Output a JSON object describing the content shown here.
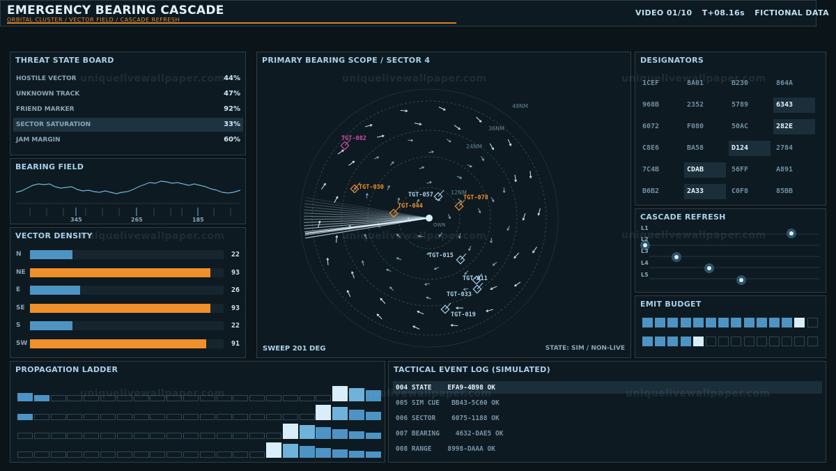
{
  "header": {
    "title": "EMERGENCY BEARING CASCADE",
    "subtitle": "ORBITAL CLUSTER / VECTOR FIELD / CASCADE REFRESH",
    "video": "VIDEO 01/10",
    "time": "T+08.16s",
    "tag": "FICTIONAL DATA"
  },
  "watermark": "uniquelivewallpaper.com",
  "threat_board": {
    "title": "THREAT STATE BOARD",
    "rows": [
      {
        "label": "HOSTILE VECTOR",
        "value": "44%"
      },
      {
        "label": "UNKNOWN TRACK",
        "value": "47%"
      },
      {
        "label": "FRIEND MARKER",
        "value": "92%"
      },
      {
        "label": "SECTOR SATURATION",
        "value": "33%"
      },
      {
        "label": "JAM MARGIN",
        "value": "60%"
      }
    ],
    "highlight_index": 3
  },
  "bearing_field": {
    "title": "BEARING FIELD",
    "ticks": [
      "345",
      "265",
      "185"
    ]
  },
  "vector_density": {
    "title": "VECTOR DENSITY",
    "rows": [
      {
        "label": "N",
        "value": 22,
        "color": "#4d94c4"
      },
      {
        "label": "NE",
        "value": 93,
        "color": "#f0902b"
      },
      {
        "label": "E",
        "value": 26,
        "color": "#4d94c4"
      },
      {
        "label": "SE",
        "value": 93,
        "color": "#f0902b"
      },
      {
        "label": "S",
        "value": 22,
        "color": "#4d94c4"
      },
      {
        "label": "SW",
        "value": 91,
        "color": "#f0902b"
      }
    ],
    "max": 100
  },
  "scope": {
    "title": "PRIMARY BEARING SCOPE / SECTOR 4",
    "sweep": "SWEEP 201 DEG",
    "state": "STATE: SIM / NON-LIVE",
    "rings": [
      "12NM",
      "24NM",
      "36NM",
      "48NM"
    ],
    "own": "OWN",
    "targets": [
      {
        "label": "TGT-082",
        "color": "#c94fa6"
      },
      {
        "label": "TGT-030",
        "color": "#f0902b"
      },
      {
        "label": "TGT-057",
        "color": "#a9d1ea"
      },
      {
        "label": "TGT-078",
        "color": "#f0902b"
      },
      {
        "label": "TGT-044",
        "color": "#f0902b"
      },
      {
        "label": "TGT-015",
        "color": "#a9d1ea"
      },
      {
        "label": "TGT-011",
        "color": "#a9d1ea"
      },
      {
        "label": "TGT-033",
        "color": "#a9d1ea"
      },
      {
        "label": "TGT-019",
        "color": "#a9d1ea"
      }
    ]
  },
  "designators": {
    "title": "DESIGNATORS",
    "codes": [
      "1CEF",
      "8A01",
      "B230",
      "864A",
      "968B",
      "2352",
      "5789",
      "6343",
      "6072",
      "F080",
      "50AC",
      "282E",
      "C8E6",
      "BA58",
      "D124",
      "2784",
      "7C4B",
      "CDAB",
      "56FF",
      "A891",
      "B6B2",
      "2A33",
      "C0F8",
      "85BB"
    ],
    "highlighted": [
      7,
      11,
      14,
      17,
      21
    ]
  },
  "cascade_refresh": {
    "title": "CASCADE REFRESH",
    "levels": [
      "L1",
      "L2",
      "L3",
      "L4",
      "L5"
    ]
  },
  "emit_budget": {
    "title": "EMIT BUDGET",
    "row1_filled": 12,
    "row1_bright": 1,
    "row2_filled": 4,
    "row2_bright": 1,
    "cells_per_row": 14
  },
  "propagation_ladder": {
    "title": "PROPAGATION LADDER"
  },
  "event_log": {
    "title": "TACTICAL EVENT LOG (SIMULATED)",
    "rows": [
      "004 STATE    EFA9-4B98 OK",
      "005 SIM CUE   BB43-5C60 OK",
      "006 SECTOR    6075-1188 OK",
      "007 BEARING    4632-DAE5 OK",
      "008 RANGE    8998-DAAA OK"
    ],
    "highlight_index": 0
  }
}
